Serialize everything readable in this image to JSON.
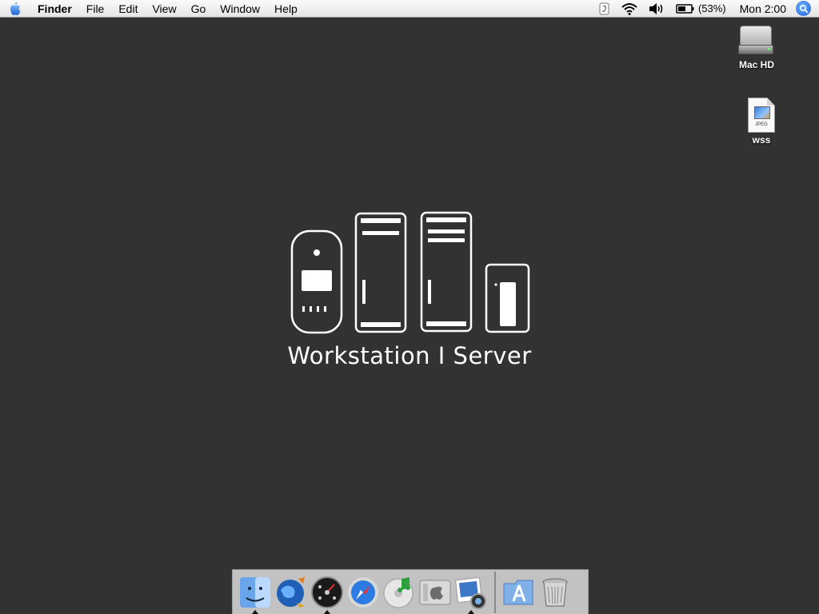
{
  "menubar": {
    "apple_icon": "apple-logo-icon",
    "app_name": "Finder",
    "menus": [
      "File",
      "Edit",
      "View",
      "Go",
      "Window",
      "Help"
    ],
    "status": {
      "script_icon": "script-menu-icon",
      "wifi_icon": "wifi-icon",
      "volume_icon": "volume-icon",
      "battery_icon": "battery-icon",
      "battery_percent": "(53%)",
      "clock": "Mon 2:00",
      "spotlight_icon": "spotlight-search-icon"
    }
  },
  "desktop": {
    "icons": [
      {
        "label": "Mac HD",
        "icon": "hard-drive-icon"
      },
      {
        "label": "wss",
        "icon": "jpeg-document-icon",
        "type_badge": "JPEG"
      }
    ],
    "background_color": "#323233"
  },
  "logo": {
    "graphic": "mac-pro-xserve-family-icon",
    "title": "Workstation I Server"
  },
  "dock": {
    "apps": [
      {
        "icon": "finder-icon",
        "running": true
      },
      {
        "icon": "network-globe-icon",
        "running": false
      },
      {
        "icon": "dashboard-icon",
        "running": true
      },
      {
        "icon": "safari-icon",
        "running": false
      },
      {
        "icon": "itunes-icon",
        "running": false
      },
      {
        "icon": "boot-camp-icon",
        "running": false
      },
      {
        "icon": "iphoto-icon",
        "running": true
      }
    ],
    "folders": [
      {
        "icon": "applications-folder-icon"
      },
      {
        "icon": "trash-icon"
      }
    ]
  }
}
